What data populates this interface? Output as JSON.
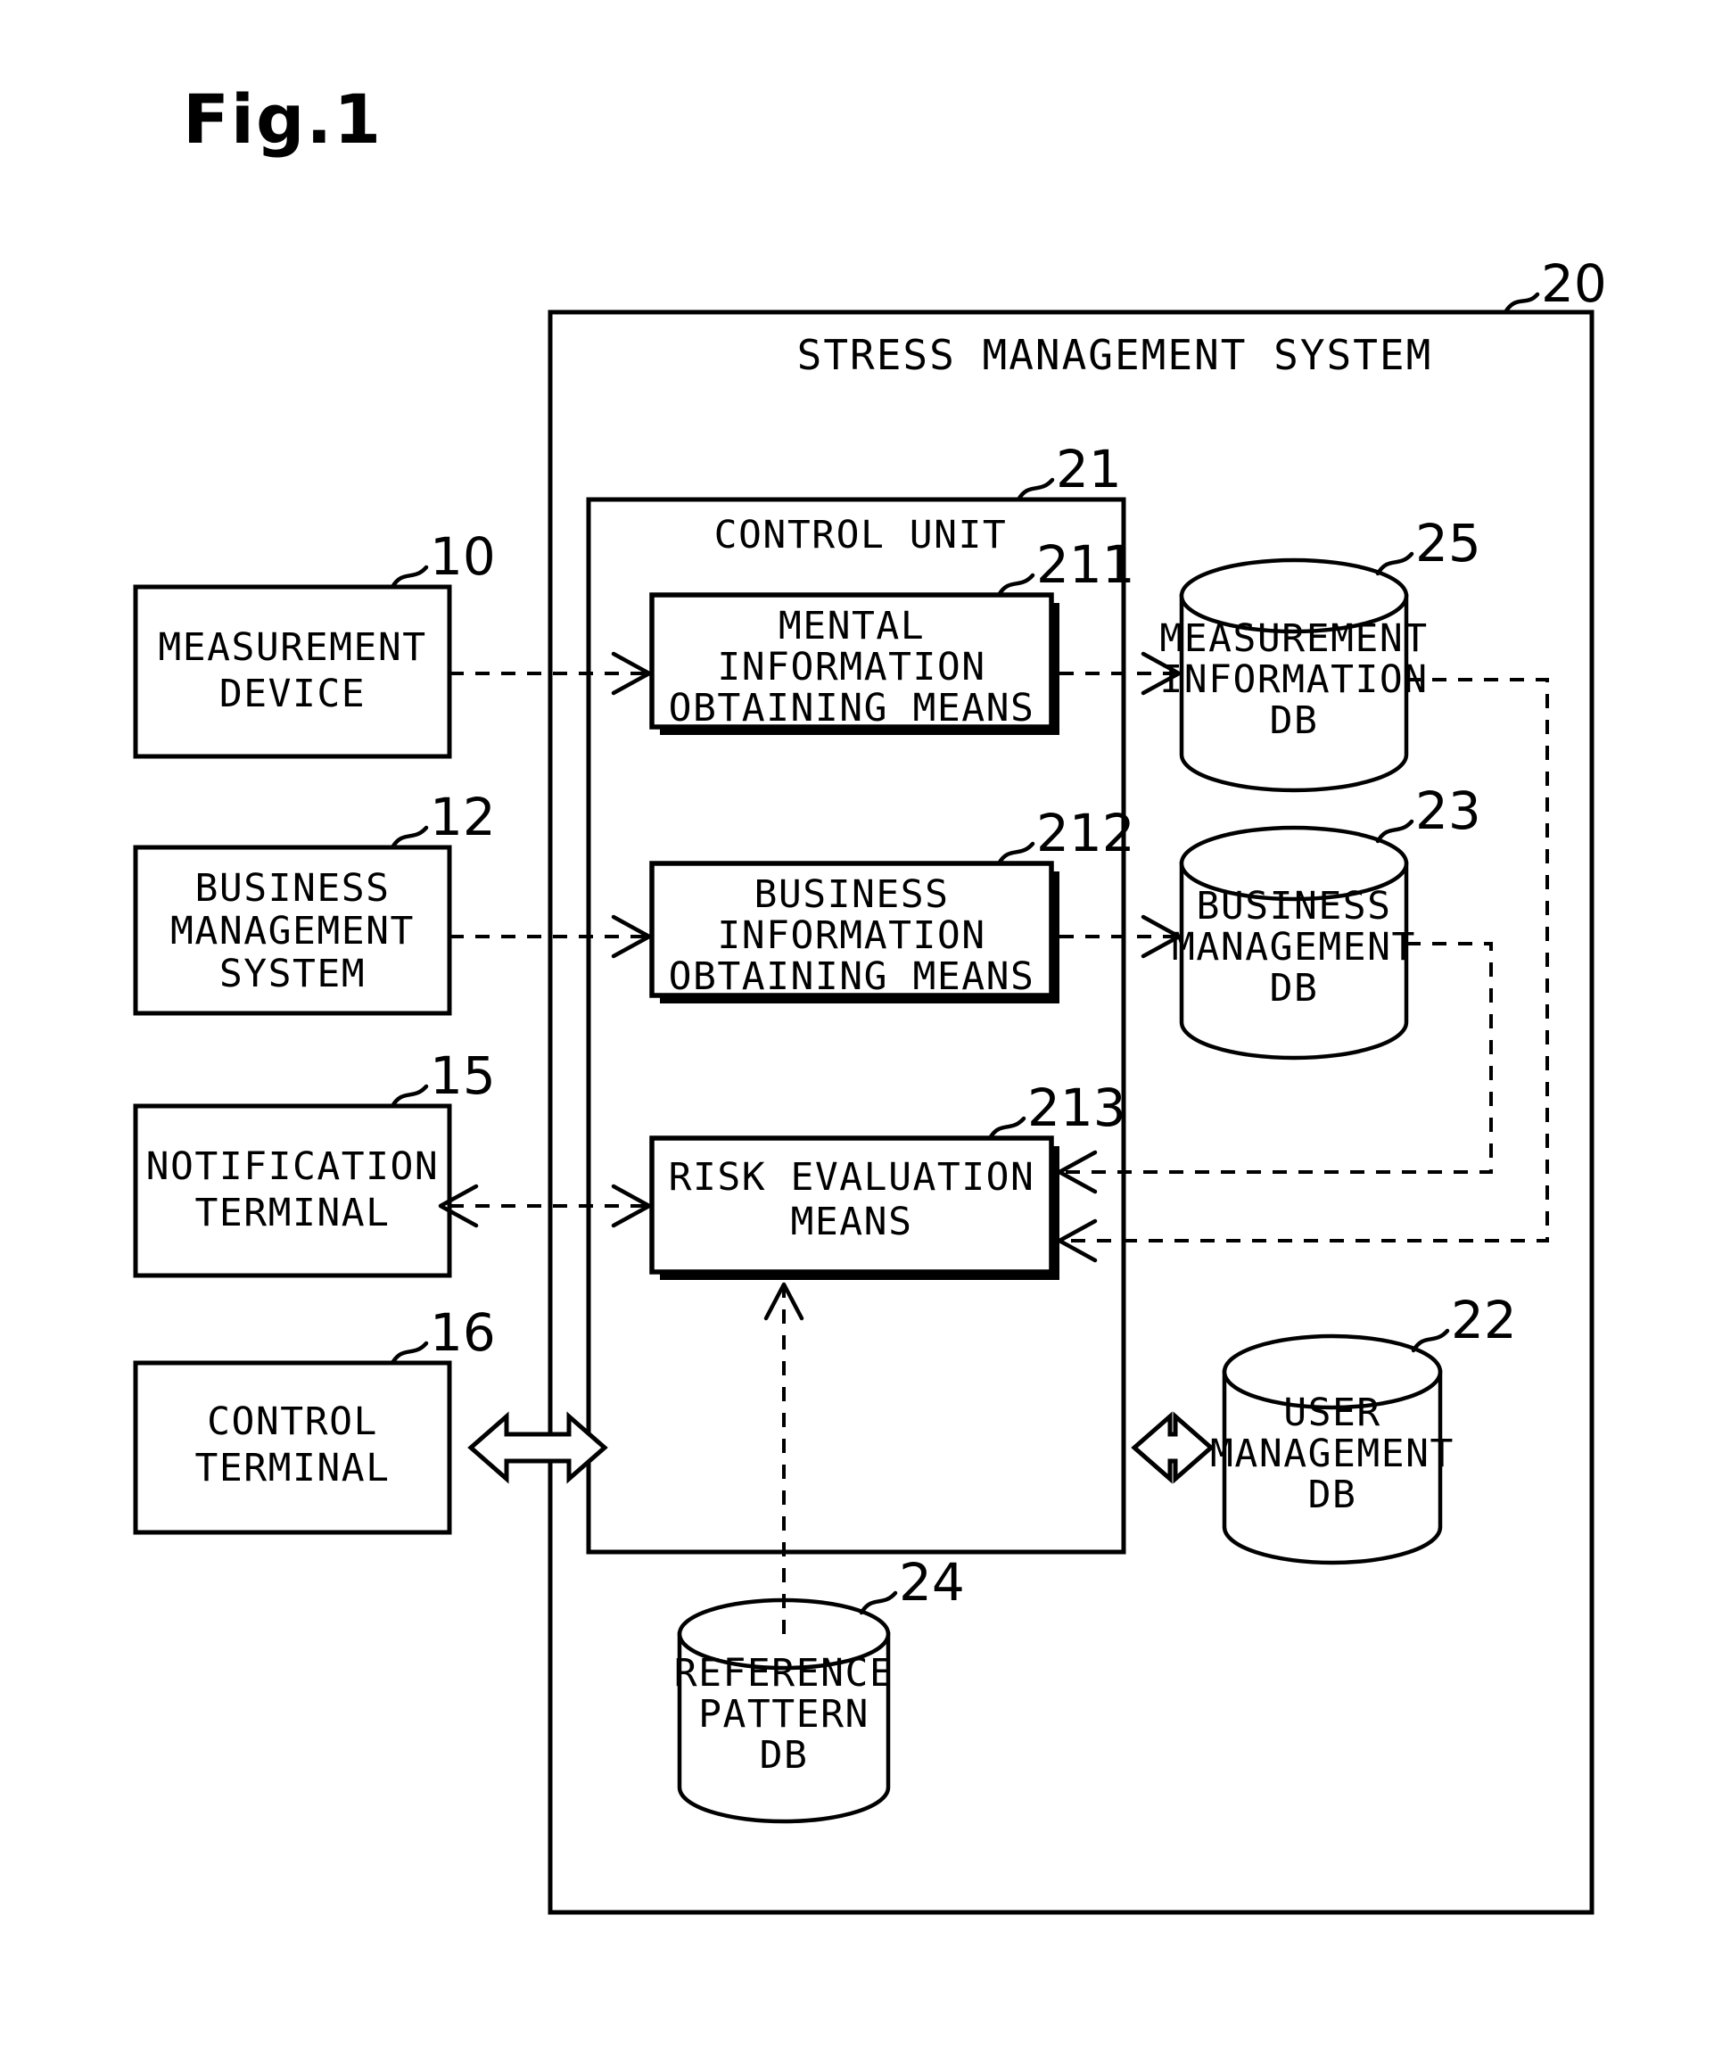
{
  "figure": {
    "title": "Fig.1",
    "type": "patent-block-diagram"
  },
  "system": {
    "label": "STRESS MANAGEMENT SYSTEM",
    "ref": "20"
  },
  "control_unit": {
    "label": "CONTROL UNIT",
    "ref": "21"
  },
  "external_blocks": [
    {
      "id": "measurement-device",
      "ref": "10",
      "lines": [
        "MEASUREMENT",
        "DEVICE"
      ]
    },
    {
      "id": "business-management-system",
      "ref": "12",
      "lines": [
        "BUSINESS",
        "MANAGEMENT",
        "SYSTEM"
      ]
    },
    {
      "id": "notification-terminal",
      "ref": "15",
      "lines": [
        "NOTIFICATION",
        "TERMINAL"
      ]
    },
    {
      "id": "control-terminal",
      "ref": "16",
      "lines": [
        "CONTROL",
        "TERMINAL"
      ]
    }
  ],
  "means_blocks": [
    {
      "id": "mental-information-obtaining-means",
      "ref": "211",
      "lines": [
        "MENTAL",
        "INFORMATION",
        "OBTAINING MEANS"
      ]
    },
    {
      "id": "business-information-obtaining-means",
      "ref": "212",
      "lines": [
        "BUSINESS",
        "INFORMATION",
        "OBTAINING MEANS"
      ]
    },
    {
      "id": "risk-evaluation-means",
      "ref": "213",
      "lines": [
        "RISK EVALUATION",
        "MEANS"
      ]
    }
  ],
  "databases": [
    {
      "id": "measurement-information-db",
      "ref": "25",
      "lines": [
        "MEASUREMENT",
        "INFORMATION",
        "DB"
      ]
    },
    {
      "id": "business-management-db",
      "ref": "23",
      "lines": [
        "BUSINESS",
        "MANAGEMENT",
        "DB"
      ]
    },
    {
      "id": "user-management-db",
      "ref": "22",
      "lines": [
        "USER",
        "MANAGEMENT",
        "DB"
      ]
    },
    {
      "id": "reference-pattern-db",
      "ref": "24",
      "lines": [
        "REFERENCE",
        "PATTERN",
        "DB"
      ]
    }
  ],
  "colors": {
    "stroke": "#000000",
    "background": "#ffffff"
  }
}
